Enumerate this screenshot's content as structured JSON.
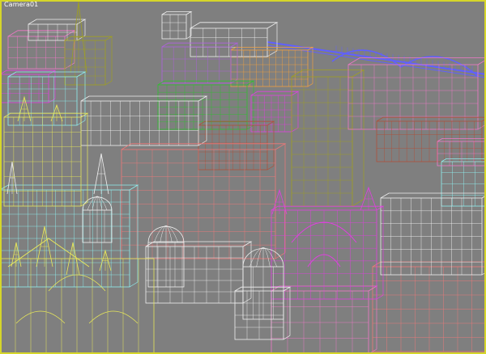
{
  "viewport": {
    "camera_label": "Camera01",
    "background_color": "#7f7f7f",
    "active_border_color": "#d6d62a"
  },
  "scene": {
    "render_mode": "wireframe",
    "object_colors": {
      "yellow": "#e8e85a",
      "cyan": "#8ff0f0",
      "pink": "#f078c8",
      "salmon": "#f07878",
      "magenta": "#e040e0",
      "orange": "#f0a040",
      "green": "#30c030",
      "blue": "#6060ff",
      "brown": "#b0503a",
      "white": "#f0f0f0",
      "olive": "#a0a020",
      "red": "#ff4040",
      "violet": "#b060e0"
    }
  }
}
